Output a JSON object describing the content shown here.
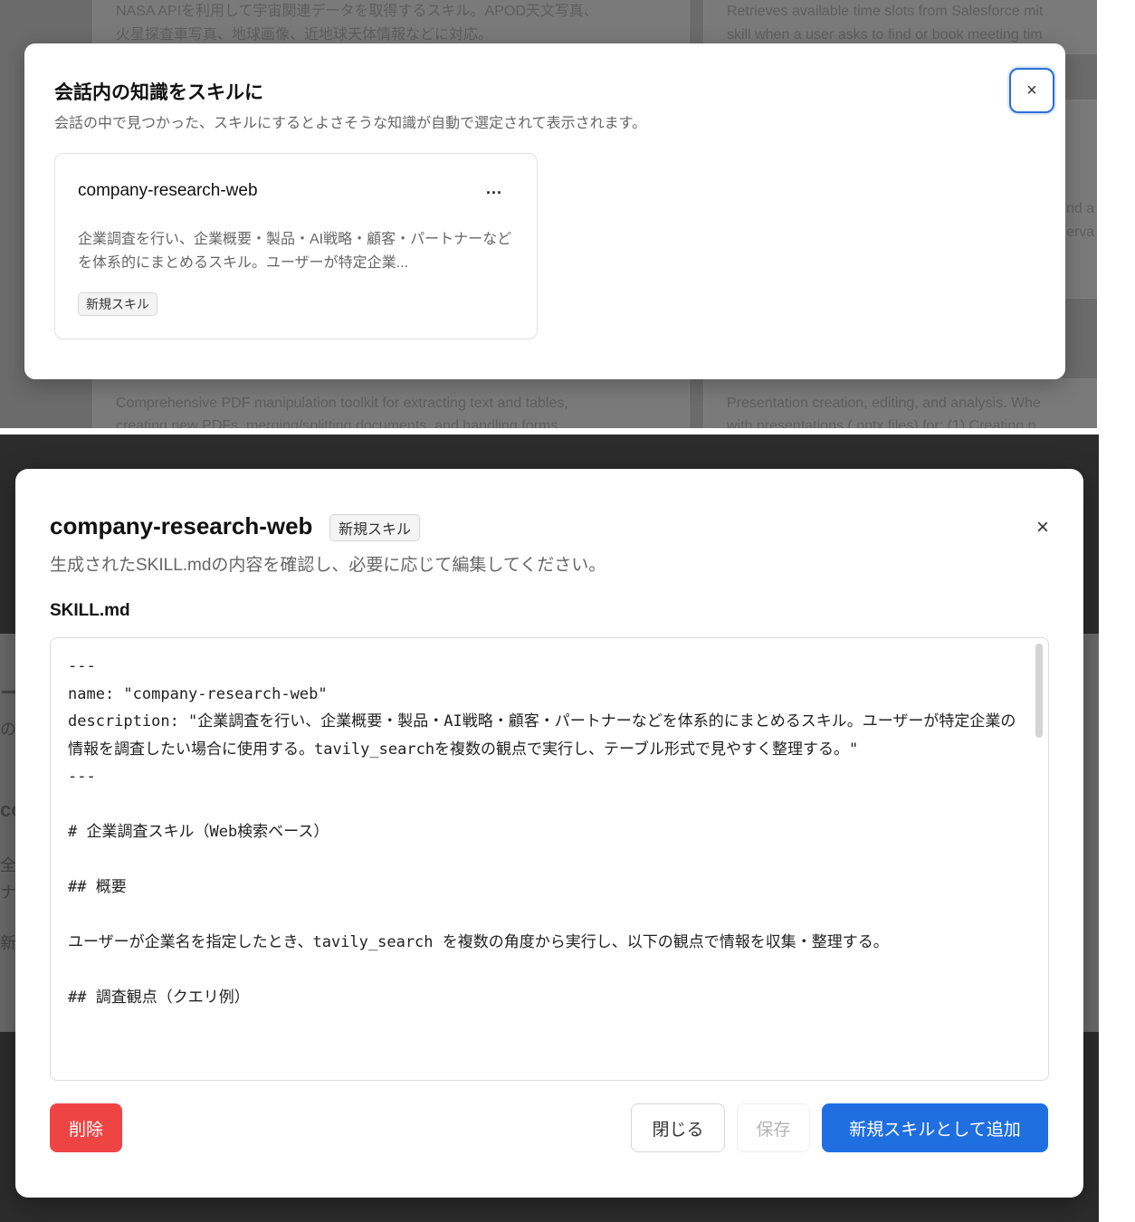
{
  "top_screen": {
    "background": {
      "texts": [
        "NASA APIを利用して宇宙関連データを取得するスキル。APOD天文写真、",
        "火星探査車写真、地球画像、近地球天体情報などに対応。",
        "Retrieves available time slots from Salesforce mit",
        "skill when a user asks to find or book meeting tim",
        "Comprehensive PDF manipulation toolkit for extracting text and tables,",
        "creating new PDFs, merging/splitting documents, and handling forms",
        "Presentation creation, editing, and analysis. Whe",
        "with presentations (.pptx files) for: (1) Creating n",
        "nd a",
        "erva"
      ]
    },
    "dialog": {
      "title": "会話内の知識をスキルに",
      "subtitle": "会話の中で見つかった、スキルにするとよさそうな知識が自動で選定されて表示されます。",
      "close_label": "×",
      "skill_card": {
        "name": "company-research-web",
        "more_label": "...",
        "description": "企業調査を行い、企業概要・製品・AI戦略・顧客・パートナーなどを体系的にまとめるスキル。ユーザーが特定企業...",
        "badge": "新規スキル"
      }
    }
  },
  "bottom_screen": {
    "background": {
      "fragments": [
        "ー",
        "の",
        "co",
        "全",
        "ナ",
        "新"
      ]
    },
    "dialog": {
      "title": "company-research-web",
      "badge": "新規スキル",
      "close_label": "×",
      "subtitle": "生成されたSKILL.mdの内容を確認し、必要に応じて編集してください。",
      "editor_label": "SKILL.md",
      "editor_lines": [
        "---",
        "name: \"company-research-web\"",
        "description: \"企業調査を行い、企業概要・製品・AI戦略・顧客・パートナーなどを体系的にまとめるスキル。ユーザーが特定企業の情報を調査したい場合に使用する。tavily_searchを複数の観点で実行し、テーブル形式で見やすく整理する。\"",
        "---",
        "",
        "# 企業調査スキル（Web検索ベース）",
        "",
        "## 概要",
        "",
        "ユーザーが企業名を指定したとき、tavily_search を複数の角度から実行し、以下の観点で情報を収集・整理する。",
        "",
        "## 調査観点（クエリ例）"
      ],
      "buttons": {
        "delete": "削除",
        "close": "閉じる",
        "save": "保存",
        "add": "新規スキルとして追加"
      }
    }
  },
  "colors": {
    "primary": "#1f6fe0",
    "danger": "#ef4444",
    "focus_ring": "#2a6fd6"
  }
}
